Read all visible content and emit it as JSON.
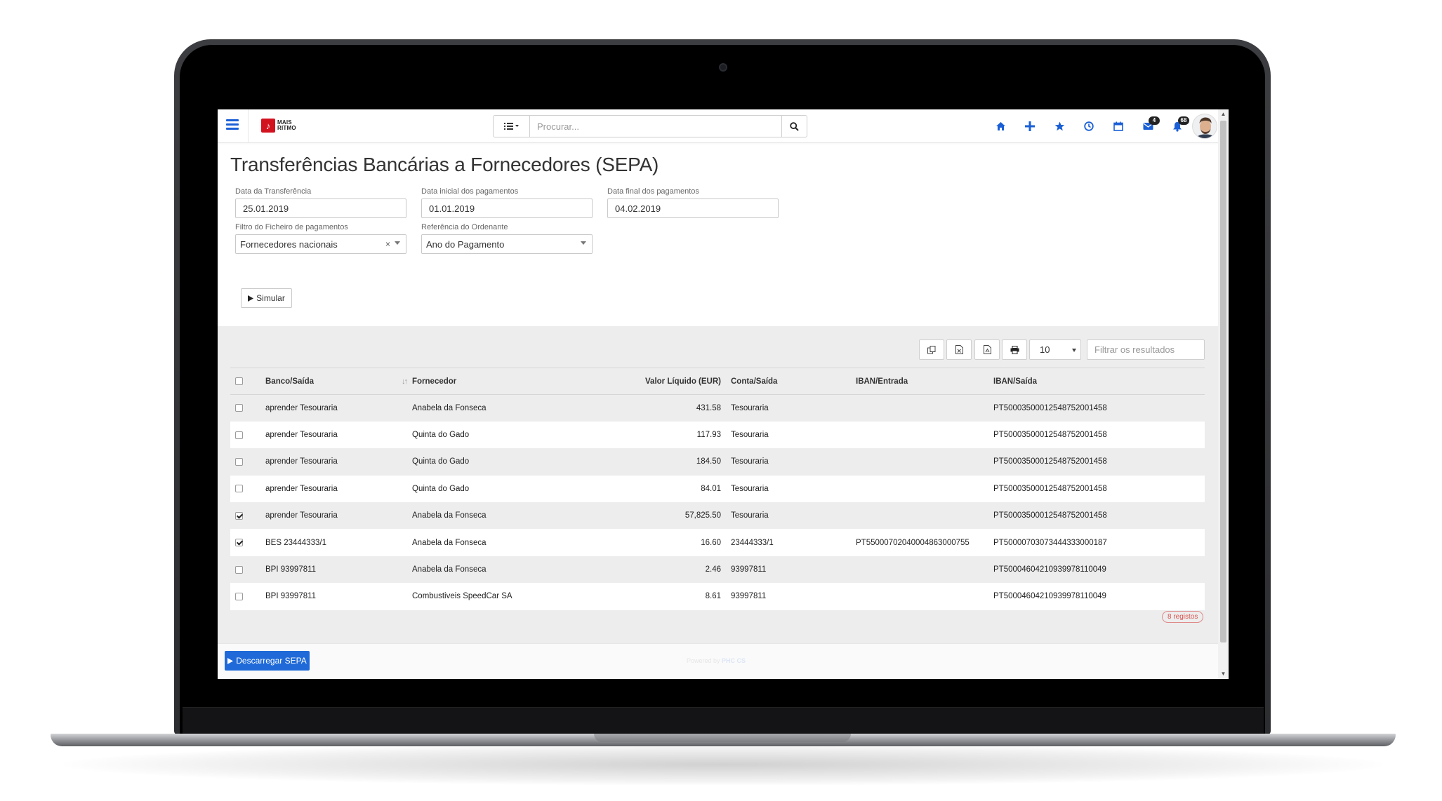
{
  "app": {
    "brand_line1": "MAIS",
    "brand_line2": "RITMO",
    "brand_mark": "♪",
    "search_placeholder": "Procurar...",
    "badges": {
      "messages": "4",
      "notifications": "68"
    },
    "icons": [
      "home-icon",
      "plus-icon",
      "star-icon",
      "clock-icon",
      "calendar-icon",
      "mail-icon",
      "bell-icon"
    ],
    "accent_color": "#1a5fd6"
  },
  "page": {
    "title": "Transferências Bancárias a Fornecedores (SEPA)",
    "fields": {
      "data_transferencia_label": "Data da Transferência",
      "data_transferencia_value": "25.01.2019",
      "data_inicial_label": "Data inicial dos pagamentos",
      "data_inicial_value": "01.01.2019",
      "data_final_label": "Data final dos pagamentos",
      "data_final_value": "04.02.2019",
      "filtro_label": "Filtro do Ficheiro de pagamentos",
      "filtro_value": "Fornecedores nacionais",
      "clear_symbol": "×",
      "referencia_label": "Referência do Ordenante",
      "referencia_value": "Ano do Pagamento"
    },
    "simulate_label": "Simular"
  },
  "results": {
    "page_size": "10",
    "filter_placeholder": "Filtrar os resultados",
    "columns": [
      "Banco/Saída",
      "Fornecedor",
      "Valor Líquido (EUR)",
      "Conta/Saída",
      "IBAN/Entrada",
      "IBAN/Saída"
    ],
    "rows": [
      {
        "checked": false,
        "banco": "aprender Tesouraria",
        "fornecedor": "Anabela da Fonseca",
        "valor": "431.58",
        "conta": "Tesouraria",
        "iban_in": "",
        "iban_out": "PT50003500012548752001458"
      },
      {
        "checked": false,
        "banco": "aprender Tesouraria",
        "fornecedor": "Quinta do Gado",
        "valor": "117.93",
        "conta": "Tesouraria",
        "iban_in": "",
        "iban_out": "PT50003500012548752001458"
      },
      {
        "checked": false,
        "banco": "aprender Tesouraria",
        "fornecedor": "Quinta do Gado",
        "valor": "184.50",
        "conta": "Tesouraria",
        "iban_in": "",
        "iban_out": "PT50003500012548752001458"
      },
      {
        "checked": false,
        "banco": "aprender Tesouraria",
        "fornecedor": "Quinta do Gado",
        "valor": "84.01",
        "conta": "Tesouraria",
        "iban_in": "",
        "iban_out": "PT50003500012548752001458"
      },
      {
        "checked": true,
        "banco": "aprender Tesouraria",
        "fornecedor": "Anabela da Fonseca",
        "valor": "57,825.50",
        "conta": "Tesouraria",
        "iban_in": "",
        "iban_out": "PT50003500012548752001458"
      },
      {
        "checked": true,
        "banco": "BES 23444333/1",
        "fornecedor": "Anabela da Fonseca",
        "valor": "16.60",
        "conta": "23444333/1",
        "iban_in": "PT55000702040004863000755",
        "iban_out": "PT50000703073444333000187"
      },
      {
        "checked": false,
        "banco": "BPI 93997811",
        "fornecedor": "Anabela da Fonseca",
        "valor": "2.46",
        "conta": "93997811",
        "iban_in": "",
        "iban_out": "PT50004604210939978110049"
      },
      {
        "checked": false,
        "banco": "BPI 93997811",
        "fornecedor": "Combustiveis SpeedCar SA",
        "valor": "8.61",
        "conta": "93997811",
        "iban_in": "",
        "iban_out": "PT50004604210939978110049"
      }
    ],
    "record_count": "8 registos"
  },
  "footer": {
    "download_label": "Descarregar SEPA",
    "powered_prefix": "Powered by",
    "powered_brand": "PHC CS"
  }
}
